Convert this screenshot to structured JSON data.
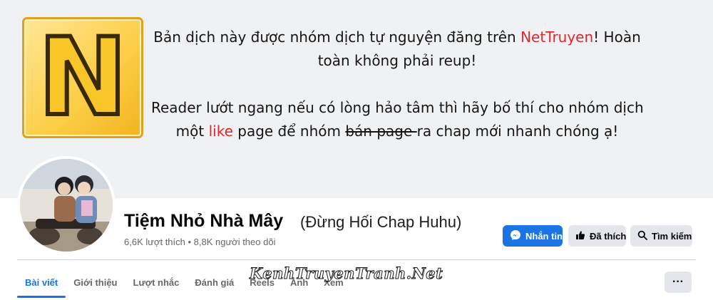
{
  "cover": {
    "logo_letter": "N",
    "notice": {
      "line1_pre": "Bản dịch này được nhóm dịch tự nguyện đăng trên ",
      "line1_brand": "NetTruyen",
      "line1_post": "! Hoàn",
      "line2": "toàn không phải reup!",
      "line3": "Reader lướt ngang nếu có lòng hảo tâm thì hãy bố thí cho nhóm dịch",
      "line4_pre": "một ",
      "line4_like": "like",
      "line4_mid": " page để nhóm ",
      "line4_strike": "bán page ",
      "line4_post": "ra chap mới nhanh chóng ạ!"
    }
  },
  "profile": {
    "name": "Tiệm Nhỏ Nhà Mây",
    "alt_name": "(Đừng Hối Chap Huhu)",
    "stats": "6,6K lượt thích • 8,8K người theo dõi"
  },
  "actions": {
    "message": "Nhắn tin",
    "liked": "Đã thích",
    "search": "Tìm kiếm"
  },
  "tabs": [
    "Bài viết",
    "Giới thiệu",
    "Lượt nhắc",
    "Đánh giá",
    "Reels",
    "Ảnh",
    "Xem"
  ],
  "more_label": "···",
  "watermark": "KenhTruyenTranh.Net",
  "colors": {
    "accent": "#1b74e4",
    "brand_red": "#e0272d",
    "logo_yellow": "#f9c62a"
  },
  "icons": {
    "message": "messenger-icon",
    "liked": "thumbs-up-icon",
    "search": "search-icon",
    "more": "more-icon"
  }
}
